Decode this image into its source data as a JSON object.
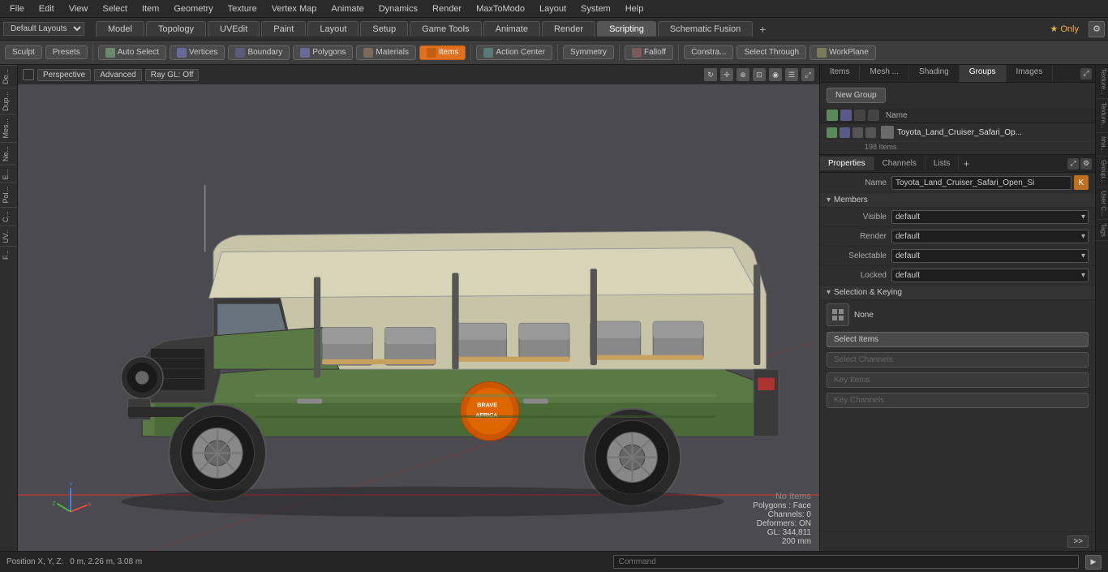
{
  "menu": {
    "items": [
      "File",
      "Edit",
      "View",
      "Select",
      "Item",
      "Geometry",
      "Texture",
      "Vertex Map",
      "Animate",
      "Dynamics",
      "Render",
      "MaxToModo",
      "Layout",
      "System",
      "Help"
    ]
  },
  "tabs": {
    "items": [
      "Model",
      "Topology",
      "UVEdit",
      "Paint",
      "Layout",
      "Setup",
      "Game Tools",
      "Animate",
      "Render",
      "Scripting",
      "Schematic Fusion"
    ],
    "active": "Scripting",
    "add_label": "+",
    "only_label": "★ Only"
  },
  "toolbar": {
    "sculpt_label": "Sculpt",
    "presets_label": "Presets",
    "auto_select_label": "Auto Select",
    "vertices_label": "Vertices",
    "boundary_label": "Boundary",
    "polygons_label": "Polygons",
    "materials_label": "Materials",
    "items_label": "Items",
    "action_center_label": "Action Center",
    "symmetry_label": "Symmetry",
    "falloff_label": "Falloff",
    "constraints_label": "Constra...",
    "select_through_label": "Select Through",
    "workplane_label": "WorkPlane"
  },
  "viewport": {
    "perspective_label": "Perspective",
    "advanced_label": "Advanced",
    "ray_gl_label": "Ray GL: Off"
  },
  "status": {
    "no_items": "No Items",
    "polygons": "Polygons : Face",
    "channels": "Channels: 0",
    "deformers": "Deformers: ON",
    "gl": "GL: 344,811",
    "size": "200 mm"
  },
  "position": {
    "label": "Position X, Y, Z:",
    "value": "0 m, 2.26 m, 3.08 m"
  },
  "right_panel": {
    "top_tabs": [
      "Items",
      "Mesh ...",
      "Shading",
      "Groups",
      "Images"
    ],
    "active_top_tab": "Groups",
    "new_group_label": "New Group",
    "name_col": "Name",
    "group_name": "Toyota_Land_Cruiser_Safari_Op...",
    "group_count": "198 Items",
    "group_full_name": "Toyota_Land_Cruiser_Safari_Open_Si"
  },
  "properties": {
    "tabs": [
      "Properties",
      "Channels",
      "Lists"
    ],
    "active_tab": "Properties",
    "add_label": "+",
    "name_label": "Name",
    "name_value": "Toyota_Land_Cruiser_Safari_Open_Si",
    "members_label": "Members",
    "visible_label": "Visible",
    "visible_value": "default",
    "render_label": "Render",
    "render_value": "default",
    "selectable_label": "Selectable",
    "selectable_value": "default",
    "locked_label": "Locked",
    "locked_value": "default",
    "selection_keying_label": "Selection & Keying",
    "none_label": "None",
    "select_items_label": "Select Items",
    "select_channels_label": "Select Channels",
    "key_items_label": "Key Items",
    "key_channels_label": "Key Channels"
  },
  "right_labels": [
    "Texture...",
    "Texture...",
    "Ima...",
    "Group...",
    "User C...",
    "Tags"
  ],
  "command_bar": {
    "label": "Command",
    "placeholder": "Command"
  },
  "left_labels": [
    "De...",
    "Dup...",
    "Mes...",
    "Ne...",
    "E...",
    "Pol...",
    "C...",
    "UV..",
    "F..."
  ]
}
